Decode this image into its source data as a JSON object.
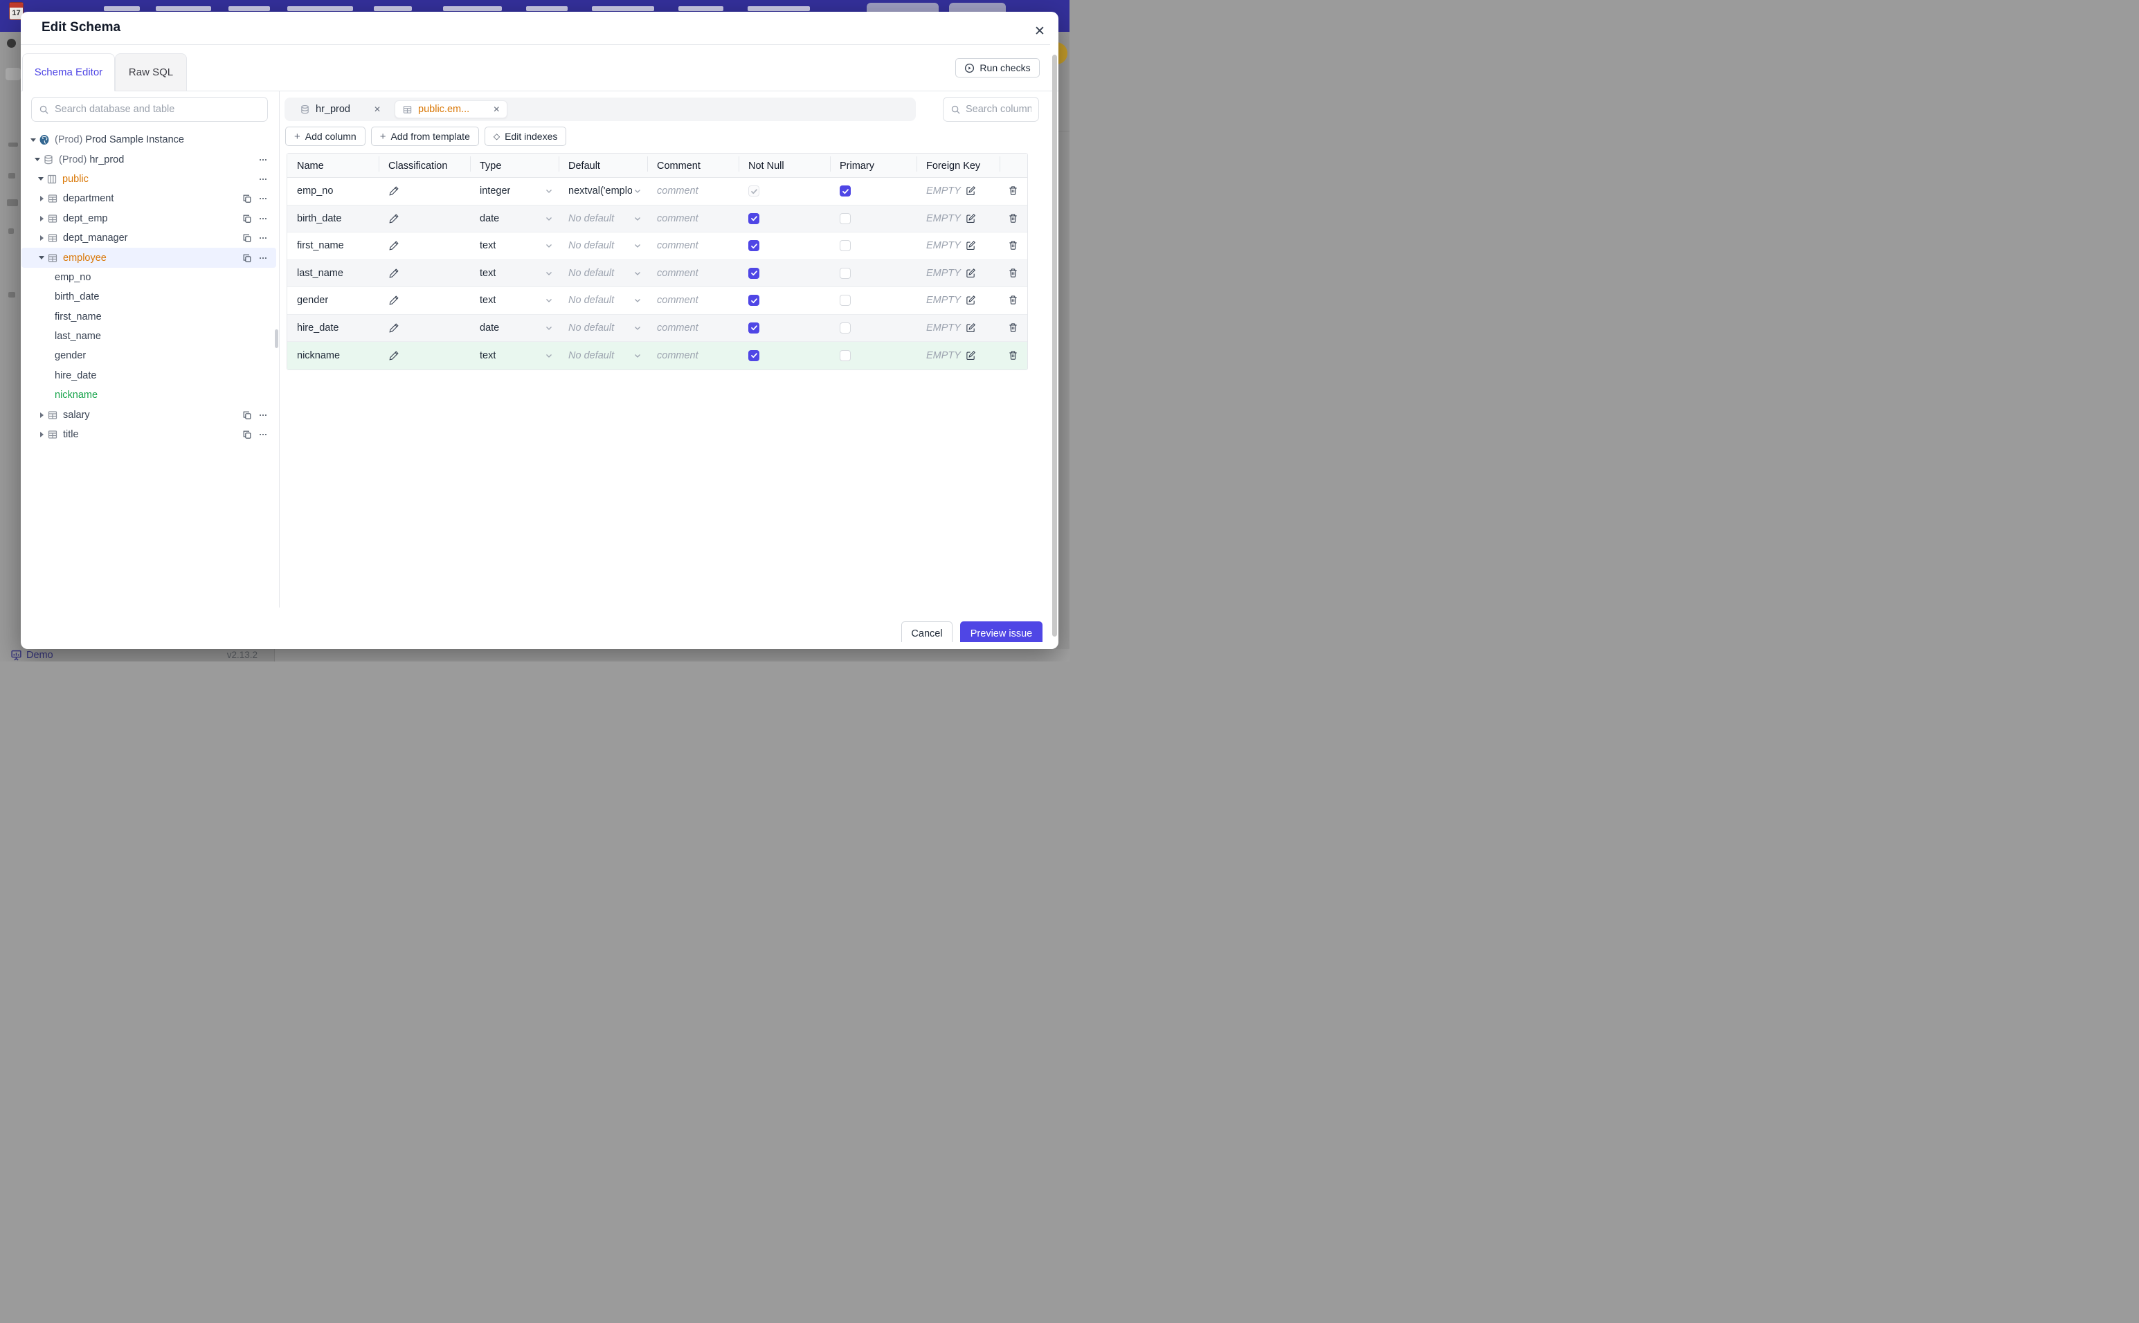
{
  "colors": {
    "accent": "#4f46e5",
    "banner": "#34309b",
    "schema_orange": "#d97706",
    "new_green": "#16a34a",
    "added_row_bg": "#e9f7ef"
  },
  "backdrop": {
    "footer": {
      "brand": "Demo",
      "version": "v2.13.2"
    }
  },
  "modal": {
    "title": "Edit Schema",
    "close_glyph": "✕",
    "tabs": [
      {
        "label": "Schema Editor",
        "active": true
      },
      {
        "label": "Raw SQL",
        "active": false
      }
    ],
    "run_checks_label": "Run checks",
    "sidebar": {
      "search_placeholder": "Search database and table",
      "tree": [
        {
          "level": 0,
          "arrow": "down",
          "icon": "postgres",
          "prefix": "(Prod)",
          "label": "Prod Sample Instance",
          "actions": []
        },
        {
          "level": 1,
          "arrow": "down",
          "icon": "database",
          "prefix": "(Prod)",
          "label": "hr_prod",
          "actions": [
            "more"
          ]
        },
        {
          "level": 2,
          "arrow": "down",
          "icon": "schema",
          "label": "public",
          "color": "orange",
          "actions": [
            "more"
          ]
        },
        {
          "level": 3,
          "arrow": "right",
          "icon": "table",
          "label": "department",
          "actions": [
            "copy",
            "more"
          ]
        },
        {
          "level": 3,
          "arrow": "right",
          "icon": "table",
          "label": "dept_emp",
          "actions": [
            "copy",
            "more"
          ]
        },
        {
          "level": 3,
          "arrow": "right",
          "icon": "table",
          "label": "dept_manager",
          "actions": [
            "copy",
            "more"
          ]
        },
        {
          "level": 3,
          "arrow": "down",
          "icon": "table",
          "label": "employee",
          "color": "orange",
          "selected": true,
          "actions": [
            "copy",
            "more"
          ]
        },
        {
          "level": "col",
          "label": "emp_no"
        },
        {
          "level": "col",
          "label": "birth_date"
        },
        {
          "level": "col",
          "label": "first_name"
        },
        {
          "level": "col",
          "label": "last_name"
        },
        {
          "level": "col",
          "label": "gender"
        },
        {
          "level": "col",
          "label": "hire_date"
        },
        {
          "level": "col",
          "label": "nickname",
          "color": "green"
        },
        {
          "level": 3,
          "arrow": "right",
          "icon": "table",
          "label": "salary",
          "actions": [
            "copy",
            "more"
          ]
        },
        {
          "level": 3,
          "arrow": "right",
          "icon": "table",
          "label": "title",
          "actions": [
            "copy",
            "more"
          ]
        }
      ]
    },
    "editor": {
      "chips": [
        {
          "icon": "database",
          "label": "hr_prod",
          "active": false,
          "close_glyph": "✕"
        },
        {
          "icon": "table",
          "label": "public.em...",
          "active": true,
          "close_glyph": "✕"
        }
      ],
      "column_search_placeholder": "Search column",
      "toolbar": [
        {
          "icon": "plus",
          "label": "Add column"
        },
        {
          "icon": "plus",
          "label": "Add from template"
        },
        {
          "icon": "diamond",
          "label": "Edit indexes"
        }
      ],
      "table": {
        "headers": [
          "Name",
          "Classification",
          "Type",
          "Default",
          "Comment",
          "Not Null",
          "Primary",
          "Foreign Key",
          ""
        ],
        "placeholders": {
          "comment": "comment",
          "no_default": "No default",
          "fk_empty": "EMPTY"
        },
        "rows": [
          {
            "name": "emp_no",
            "type": "integer",
            "default": "nextval('employ",
            "not_null": "checked-disabled",
            "primary": "checked",
            "stripe": false,
            "added": false
          },
          {
            "name": "birth_date",
            "type": "date",
            "default": null,
            "not_null": "checked",
            "primary": "unchecked",
            "stripe": true,
            "added": false
          },
          {
            "name": "first_name",
            "type": "text",
            "default": null,
            "not_null": "checked",
            "primary": "unchecked",
            "stripe": false,
            "added": false
          },
          {
            "name": "last_name",
            "type": "text",
            "default": null,
            "not_null": "checked",
            "primary": "unchecked",
            "stripe": true,
            "added": false
          },
          {
            "name": "gender",
            "type": "text",
            "default": null,
            "not_null": "checked",
            "primary": "unchecked",
            "stripe": false,
            "added": false
          },
          {
            "name": "hire_date",
            "type": "date",
            "default": null,
            "not_null": "checked",
            "primary": "unchecked",
            "stripe": true,
            "added": false
          },
          {
            "name": "nickname",
            "type": "text",
            "default": null,
            "not_null": "checked",
            "primary": "unchecked",
            "stripe": false,
            "added": true
          }
        ]
      }
    },
    "footer": {
      "cancel_label": "Cancel",
      "primary_label": "Preview issue"
    }
  }
}
